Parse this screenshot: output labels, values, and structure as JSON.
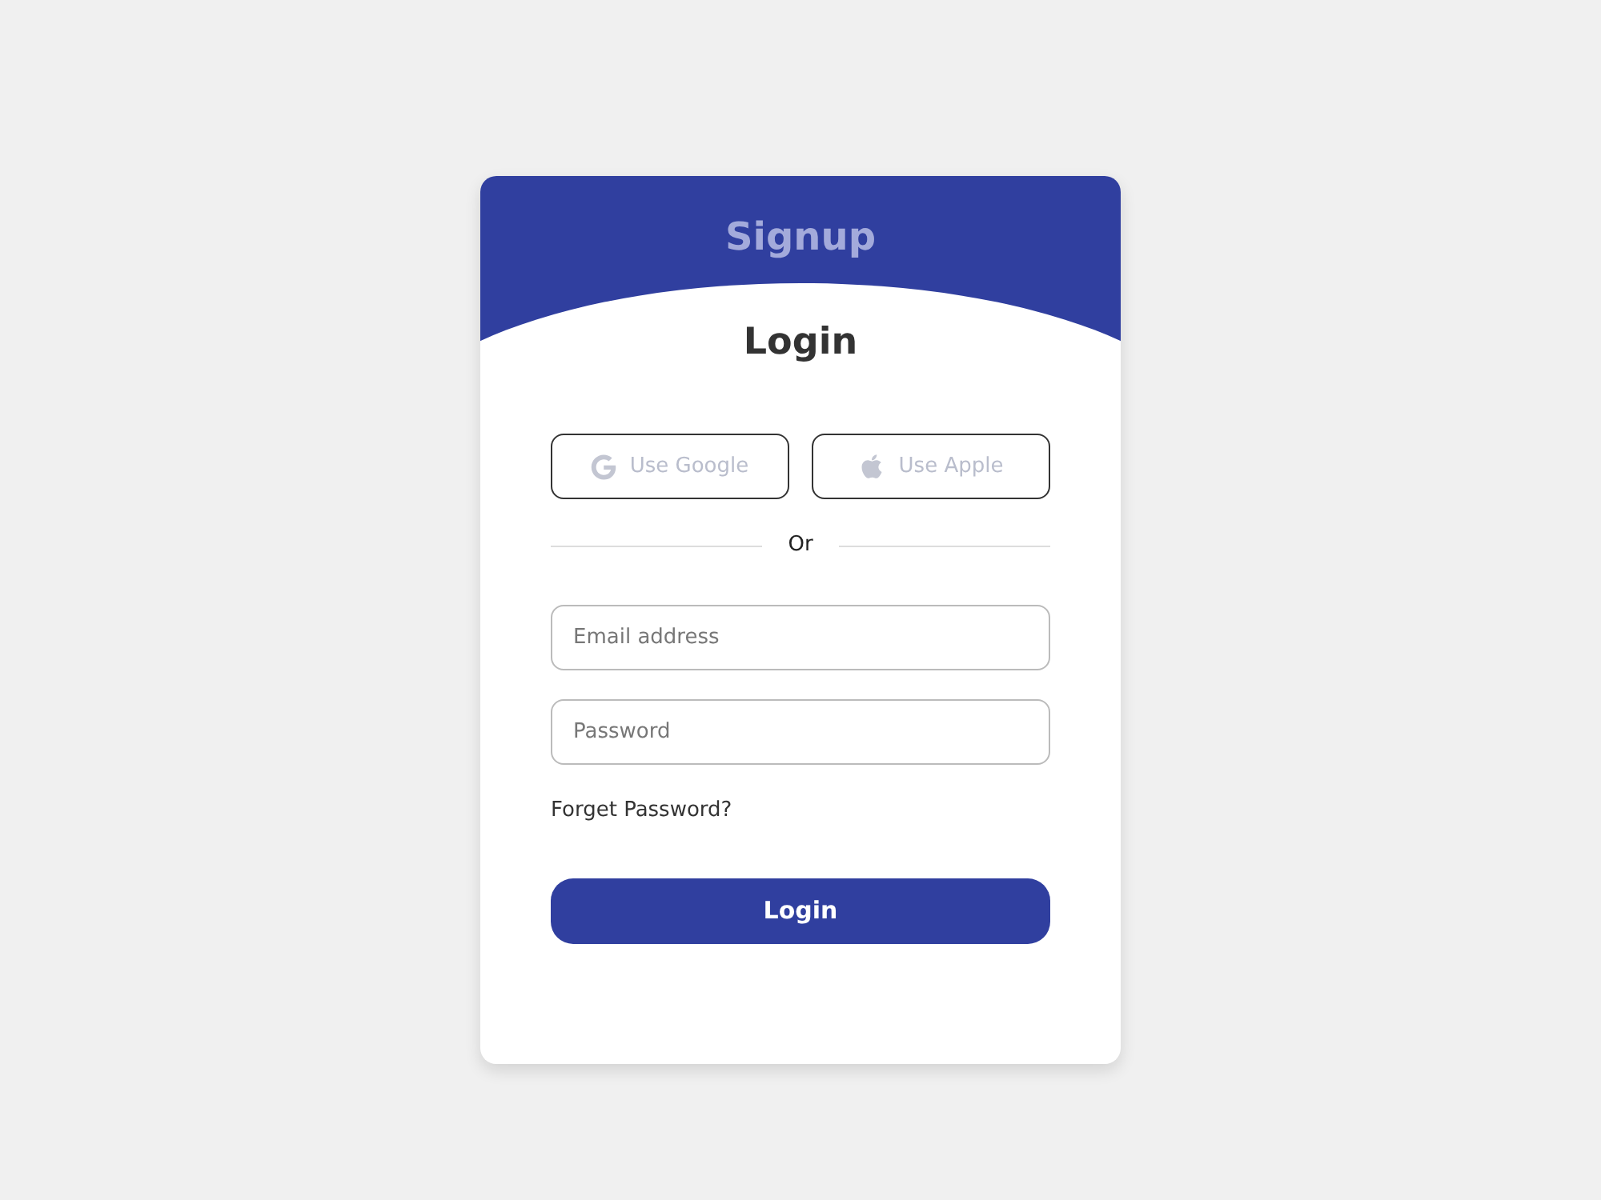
{
  "tabs": [
    {
      "label": "Signup",
      "selected": false
    },
    {
      "label": "Login",
      "selected": true
    }
  ],
  "social_buttons": [
    {
      "label": "Use Google"
    },
    {
      "label": "Use Apple"
    }
  ],
  "divider": {
    "label": "Or"
  },
  "fields": [
    {
      "placeholder": "Email address"
    },
    {
      "placeholder": "Password"
    }
  ],
  "forgot_link": "Forget Password?",
  "submit_button": "Login"
}
